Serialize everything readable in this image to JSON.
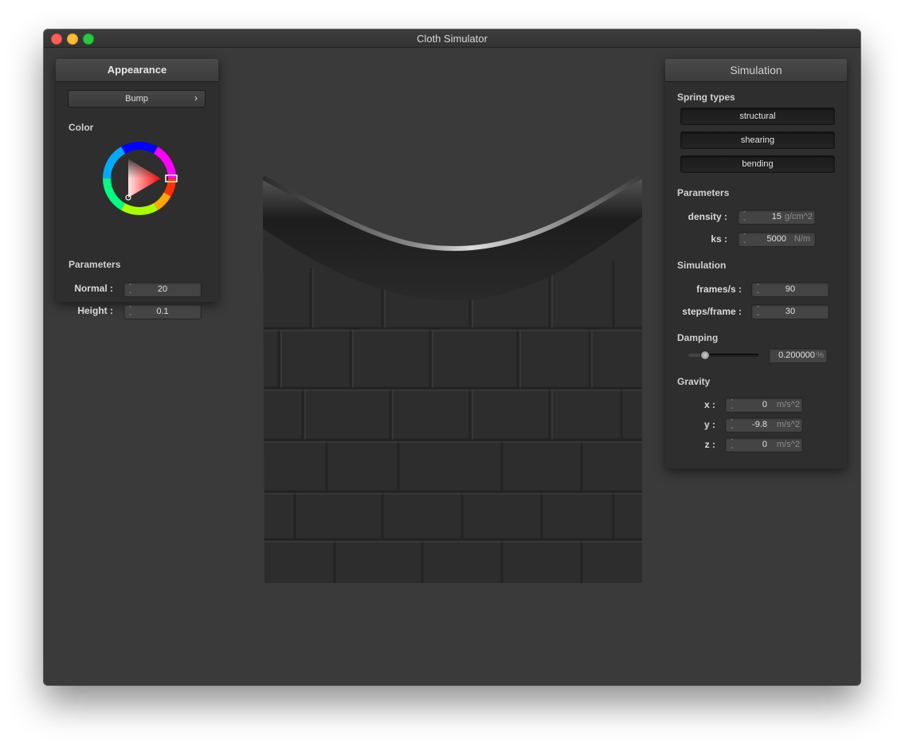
{
  "window": {
    "title": "Cloth Simulator"
  },
  "appearance": {
    "title": "Appearance",
    "shader": "Bump",
    "shader_arrow": "›",
    "color_label": "Color",
    "params_label": "Parameters",
    "normal": {
      "label": "Normal :",
      "value": "20"
    },
    "height": {
      "label": "Height :",
      "value": "0.1"
    },
    "wheel_hue_color": "#ff0000"
  },
  "simulation": {
    "title": "Simulation",
    "spring_types_label": "Spring types",
    "springs": [
      "structural",
      "shearing",
      "bending"
    ],
    "parameters_label": "Parameters",
    "density": {
      "label": "density :",
      "value": "15",
      "unit": "g/cm^2"
    },
    "ks": {
      "label": "ks :",
      "value": "5000",
      "unit": "N/m"
    },
    "sim_label": "Simulation",
    "fps": {
      "label": "frames/s :",
      "value": "90"
    },
    "steps": {
      "label": "steps/frame :",
      "value": "30"
    },
    "damping_label": "Damping",
    "damping": {
      "value": "0.200000",
      "unit": "%",
      "slider_fraction": 0.2
    },
    "gravity_label": "Gravity",
    "gx": {
      "label": "x :",
      "value": "0",
      "unit": "m/s^2"
    },
    "gy": {
      "label": "y :",
      "value": "-9.8",
      "unit": "m/s^2"
    },
    "gz": {
      "label": "z :",
      "value": "0",
      "unit": "m/s^2"
    }
  }
}
